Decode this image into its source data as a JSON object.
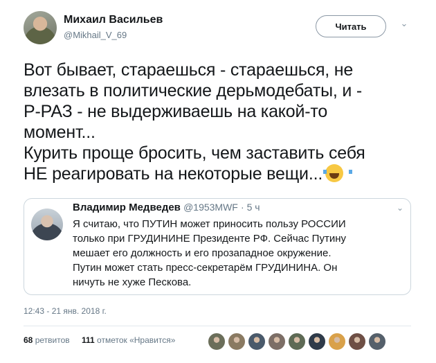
{
  "user": {
    "name": "Михаил Васильев",
    "handle": "@Mikhail_V_69"
  },
  "follow_button": "Читать",
  "tweet_lines": [
    "Вот бывает, стараешься - стараешься, не",
    "влезать в политические дерьмодебаты, и -",
    "Р-РАЗ - не выдерживаешь на какой-то",
    "момент...",
    "Курить проще бросить, чем заставить себя",
    "НЕ реагировать на некоторые вещи..."
  ],
  "quoted_tweet": {
    "name": "Владимир Медведев",
    "handle": "@1953MWF",
    "time": "· 5 ч",
    "lines": [
      "Я считаю, что ПУТИН может приносить пользу РОССИИ",
      "только при ГРУДИНИНЕ Президенте РФ. Сейчас Путину",
      "мешает его должность и его прозападное окружение.",
      "Путин может стать пресс-секретарём ГРУДИНИНА. Он",
      "ничуть не хуже Пескова."
    ]
  },
  "timestamp": "12:43 - 21 янв. 2018 г.",
  "stats": {
    "retweets_count": "68",
    "retweets_label": "ретвитов",
    "likes_count": "111",
    "likes_label": "отметок «Нравится»"
  },
  "icons": {
    "chevron": "chevron-down-icon",
    "emoji": "face-with-tears-of-joy-icon"
  },
  "liker_colors": [
    "#6b6e5a",
    "#8a7a62",
    "#4a5a6b",
    "#7c6e66",
    "#5e6a55",
    "#2f3b4a",
    "#d9a14a",
    "#6e4f45",
    "#55606b"
  ]
}
